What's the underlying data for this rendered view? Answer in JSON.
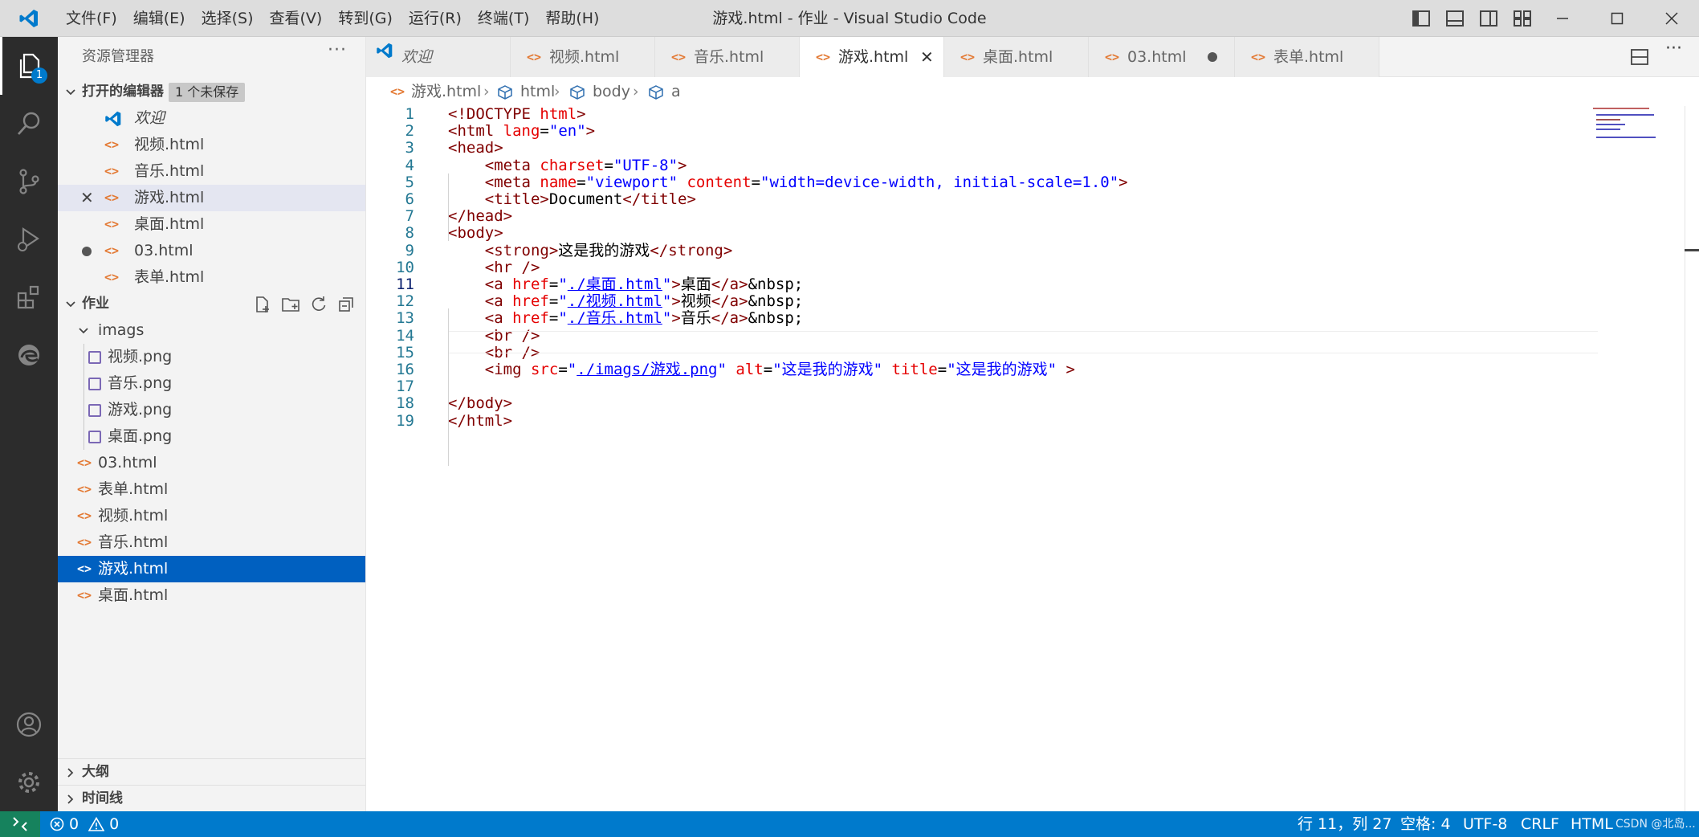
{
  "window": {
    "title": "游戏.html - 作业 - Visual Studio Code",
    "menu": [
      "文件(F)",
      "编辑(E)",
      "选择(S)",
      "查看(V)",
      "转到(G)",
      "运行(R)",
      "终端(T)",
      "帮助(H)"
    ]
  },
  "activity": {
    "explorer_badge": "1"
  },
  "sidebar": {
    "title": "资源管理器",
    "open_editors_label": "打开的编辑器",
    "unsaved_badge": "1 个未保存",
    "open_editors": [
      {
        "label": "欢迎",
        "kind": "welcome"
      },
      {
        "label": "视频.html",
        "kind": "html"
      },
      {
        "label": "音乐.html",
        "kind": "html"
      },
      {
        "label": "游戏.html",
        "kind": "html",
        "state": "active"
      },
      {
        "label": "桌面.html",
        "kind": "html"
      },
      {
        "label": "03.html",
        "kind": "html",
        "state": "dirty"
      },
      {
        "label": "表单.html",
        "kind": "html"
      }
    ],
    "workspace_label": "作业",
    "folder": "imags",
    "folder_files": [
      "视频.png",
      "音乐.png",
      "游戏.png",
      "桌面.png"
    ],
    "files": [
      "03.html",
      "表单.html",
      "视频.html",
      "音乐.html",
      "游戏.html",
      "桌面.html"
    ],
    "selected_file": "游戏.html",
    "outline_label": "大纲",
    "timeline_label": "时间线"
  },
  "tabs": [
    {
      "label": "欢迎",
      "kind": "welcome"
    },
    {
      "label": "视频.html",
      "kind": "html"
    },
    {
      "label": "音乐.html",
      "kind": "html"
    },
    {
      "label": "游戏.html",
      "kind": "html",
      "active": true
    },
    {
      "label": "桌面.html",
      "kind": "html"
    },
    {
      "label": "03.html",
      "kind": "html",
      "dirty": true
    },
    {
      "label": "表单.html",
      "kind": "html"
    }
  ],
  "breadcrumb": [
    "游戏.html",
    "html",
    "body",
    "a"
  ],
  "editor": {
    "current_line": 11,
    "lines": [
      "<!DOCTYPE html>",
      "<html lang=\"en\">",
      "<head>",
      "    <meta charset=\"UTF-8\">",
      "    <meta name=\"viewport\" content=\"width=device-width, initial-scale=1.0\">",
      "    <title>Document</title>",
      "</head>",
      "<body>",
      "    <strong>这是我的游戏</strong>",
      "    <hr />",
      "    <a href=\"./桌面.html\">桌面</a>&nbsp;",
      "    <a href=\"./视频.html\">视频</a>&nbsp;",
      "    <a href=\"./音乐.html\">音乐</a>&nbsp;",
      "    <br />",
      "    <br />",
      "    <img src=\"./imags/游戏.png\" alt=\"这是我的游戏\" title=\"这是我的游戏\" >",
      "",
      "</body>",
      "</html>"
    ]
  },
  "status": {
    "errors": "0",
    "warnings": "0",
    "position": "行 11，列 27",
    "spaces": "空格: 4",
    "encoding": "UTF-8",
    "eol": "CRLF",
    "language": "HTML",
    "watermark": "CSDN @北岛..."
  }
}
